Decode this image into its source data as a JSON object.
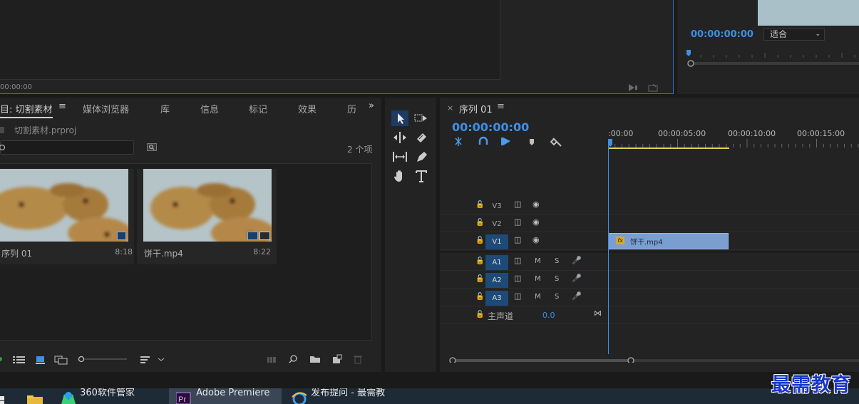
{
  "source_monitor": {
    "timecode": "00:00:00"
  },
  "program_monitor": {
    "timecode": "00:00:00:00",
    "fit_value": "适合"
  },
  "project_panel": {
    "tabs": [
      "目: 切割素材",
      "媒体浏览器",
      "库",
      "信息",
      "标记",
      "效果",
      "历"
    ],
    "more": "»",
    "project_file": "切割素材.prproj",
    "item_count": "2 个项",
    "items": [
      {
        "name": "序列 01",
        "duration": "8:18"
      },
      {
        "name": "饼干.mp4",
        "duration": "8:22"
      }
    ]
  },
  "timeline": {
    "sequence_name": "序列 01",
    "timecode": "00:00:00:00",
    "ruler_labels": [
      ":00:00",
      "00:00:05:00",
      "00:00:10:00",
      "00:00:15:00"
    ],
    "video_tracks": [
      "V3",
      "V2",
      "V1"
    ],
    "audio_tracks": [
      "A1",
      "A2",
      "A3"
    ],
    "mute_label": "M",
    "solo_label": "S",
    "clip_name": "饼干.mp4",
    "clip_fx": "fx",
    "master_label": "主声道",
    "master_value": "0.0"
  },
  "taskbar": {
    "items": [
      "360软件管家",
      "Adobe Premiere",
      "发布提问 - 最需教"
    ]
  },
  "watermark": "最需教育",
  "colors": {
    "accent": "#3d8fe8",
    "clip": "#7b9ed1",
    "work_area": "#e8d24a",
    "track_active": "#1e4a78"
  }
}
